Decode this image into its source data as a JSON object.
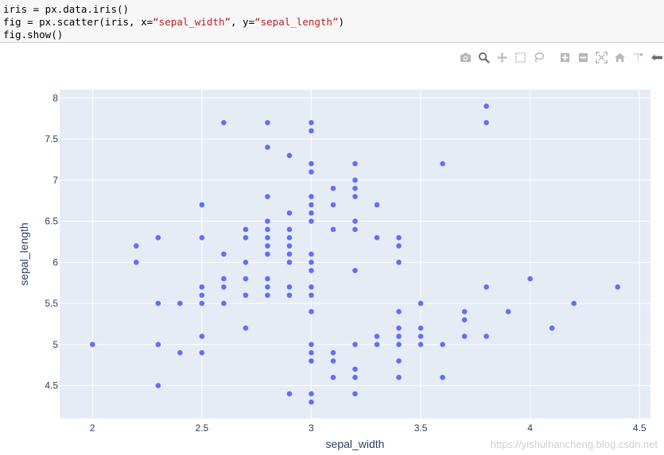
{
  "code": {
    "line1": "iris = px.data.iris()",
    "line2_prefix": "fig = px.scatter(iris, x=",
    "line2_arg_x": "“sepal_width”",
    "line2_mid": ", y=",
    "line2_arg_y": "“sepal_length”",
    "line2_suffix": ")",
    "line3": "fig.show()"
  },
  "modebar": {
    "icons": [
      "camera-icon",
      "zoom-icon",
      "pan-icon",
      "box-select-icon",
      "lasso-icon",
      "zoom-in-icon",
      "zoom-out-icon",
      "autoscale-icon",
      "home-icon",
      "spike-lines-icon",
      "hover-closest-icon"
    ],
    "color": "#b8b8b8"
  },
  "watermark": "https://yishuihancheng.blog.csdn.net",
  "chart_data": {
    "type": "scatter",
    "xlabel": "sepal_width",
    "ylabel": "sepal_length",
    "xlim": [
      1.85,
      4.55
    ],
    "ylim": [
      4.1,
      8.1
    ],
    "xticks": [
      "2",
      "2.5",
      "3",
      "3.5",
      "4",
      "4.5"
    ],
    "yticks": [
      "4.5",
      "5",
      "5.5",
      "6",
      "6.5",
      "7",
      "7.5",
      "8"
    ],
    "marker_color": "#636efa",
    "plot_bg": "#e5ecf6",
    "grid": true,
    "points": [
      [
        2.0,
        5.0
      ],
      [
        2.2,
        6.2
      ],
      [
        2.2,
        6.0
      ],
      [
        2.3,
        6.3
      ],
      [
        2.3,
        5.5
      ],
      [
        2.3,
        5.0
      ],
      [
        2.3,
        4.5
      ],
      [
        2.4,
        5.5
      ],
      [
        2.4,
        4.9
      ],
      [
        2.5,
        6.7
      ],
      [
        2.5,
        6.3
      ],
      [
        2.5,
        5.7
      ],
      [
        2.5,
        5.6
      ],
      [
        2.5,
        5.5
      ],
      [
        2.5,
        5.1
      ],
      [
        2.5,
        4.9
      ],
      [
        2.6,
        7.7
      ],
      [
        2.6,
        6.1
      ],
      [
        2.6,
        5.8
      ],
      [
        2.6,
        5.7
      ],
      [
        2.6,
        5.5
      ],
      [
        2.7,
        6.4
      ],
      [
        2.7,
        6.3
      ],
      [
        2.7,
        6.0
      ],
      [
        2.7,
        5.8
      ],
      [
        2.7,
        5.6
      ],
      [
        2.7,
        5.2
      ],
      [
        2.8,
        7.7
      ],
      [
        2.8,
        7.4
      ],
      [
        2.8,
        6.8
      ],
      [
        2.8,
        6.5
      ],
      [
        2.8,
        6.4
      ],
      [
        2.8,
        6.3
      ],
      [
        2.8,
        6.2
      ],
      [
        2.8,
        6.1
      ],
      [
        2.8,
        5.8
      ],
      [
        2.8,
        5.7
      ],
      [
        2.8,
        5.6
      ],
      [
        2.9,
        7.3
      ],
      [
        2.9,
        6.6
      ],
      [
        2.9,
        6.4
      ],
      [
        2.9,
        6.3
      ],
      [
        2.9,
        6.2
      ],
      [
        2.9,
        6.1
      ],
      [
        2.9,
        6.0
      ],
      [
        2.9,
        5.7
      ],
      [
        2.9,
        5.6
      ],
      [
        2.9,
        4.4
      ],
      [
        3.0,
        7.7
      ],
      [
        3.0,
        7.6
      ],
      [
        3.0,
        7.2
      ],
      [
        3.0,
        7.1
      ],
      [
        3.0,
        6.8
      ],
      [
        3.0,
        6.7
      ],
      [
        3.0,
        6.6
      ],
      [
        3.0,
        6.5
      ],
      [
        3.0,
        6.1
      ],
      [
        3.0,
        6.0
      ],
      [
        3.0,
        5.9
      ],
      [
        3.0,
        5.7
      ],
      [
        3.0,
        5.6
      ],
      [
        3.0,
        5.4
      ],
      [
        3.0,
        5.0
      ],
      [
        3.0,
        4.9
      ],
      [
        3.0,
        4.8
      ],
      [
        3.0,
        4.4
      ],
      [
        3.0,
        4.3
      ],
      [
        3.1,
        6.9
      ],
      [
        3.1,
        6.7
      ],
      [
        3.1,
        6.4
      ],
      [
        3.1,
        4.9
      ],
      [
        3.1,
        4.8
      ],
      [
        3.1,
        4.6
      ],
      [
        3.2,
        7.2
      ],
      [
        3.2,
        7.0
      ],
      [
        3.2,
        6.9
      ],
      [
        3.2,
        6.8
      ],
      [
        3.2,
        6.5
      ],
      [
        3.2,
        6.4
      ],
      [
        3.2,
        5.9
      ],
      [
        3.2,
        5.0
      ],
      [
        3.2,
        4.7
      ],
      [
        3.2,
        4.6
      ],
      [
        3.2,
        4.4
      ],
      [
        3.3,
        6.7
      ],
      [
        3.3,
        6.3
      ],
      [
        3.3,
        5.1
      ],
      [
        3.3,
        5.0
      ],
      [
        3.4,
        6.3
      ],
      [
        3.4,
        6.2
      ],
      [
        3.4,
        6.0
      ],
      [
        3.4,
        5.4
      ],
      [
        3.4,
        5.2
      ],
      [
        3.4,
        5.1
      ],
      [
        3.4,
        5.0
      ],
      [
        3.4,
        4.8
      ],
      [
        3.4,
        4.6
      ],
      [
        3.5,
        5.5
      ],
      [
        3.5,
        5.2
      ],
      [
        3.5,
        5.1
      ],
      [
        3.5,
        5.0
      ],
      [
        3.6,
        7.2
      ],
      [
        3.6,
        5.0
      ],
      [
        3.6,
        4.6
      ],
      [
        3.7,
        5.4
      ],
      [
        3.7,
        5.3
      ],
      [
        3.7,
        5.1
      ],
      [
        3.8,
        7.9
      ],
      [
        3.8,
        7.7
      ],
      [
        3.8,
        5.7
      ],
      [
        3.8,
        5.1
      ],
      [
        3.9,
        5.4
      ],
      [
        4.0,
        5.8
      ],
      [
        4.1,
        5.2
      ],
      [
        4.2,
        5.5
      ],
      [
        4.4,
        5.7
      ]
    ]
  }
}
